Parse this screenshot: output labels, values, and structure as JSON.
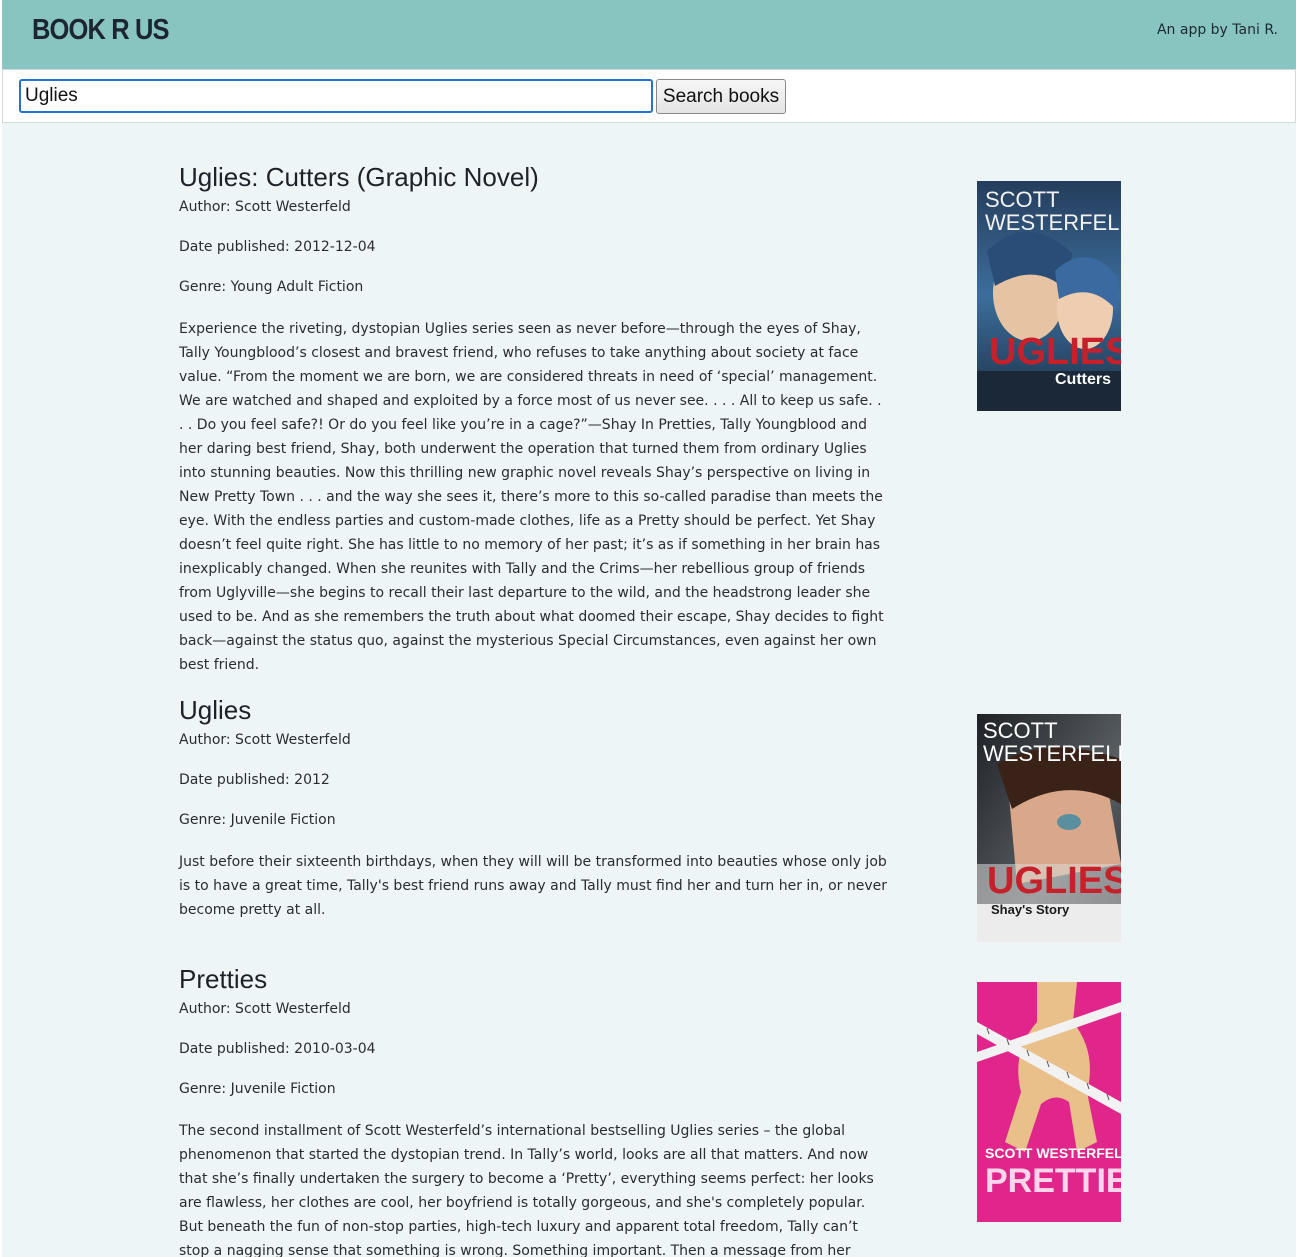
{
  "header": {
    "logo": "BOOK R US",
    "byline": "An app by Tani R."
  },
  "search": {
    "value": "Uglies",
    "button_label": "Search books"
  },
  "books": [
    {
      "title": "Uglies: Cutters (Graphic Novel)",
      "author": "Author: Scott Westerfeld",
      "date": "Date published: 2012-12-04",
      "genre": "Genre: Young Adult Fiction",
      "description": "Experience the riveting, dystopian Uglies series seen as never before—through the eyes of Shay, Tally Youngblood’s closest and bravest friend, who refuses to take anything about society at face value. “From the moment we are born, we are considered threats in need of ‘special’ management. We are watched and shaped and exploited by a force most of us never see. . . . All to keep us safe. . . . Do you feel safe?! Or do you feel like you’re in a cage?”—Shay In Pretties, Tally Youngblood and her daring best friend, Shay, both underwent the operation that turned them from ordinary Uglies into stunning beauties. Now this thrilling new graphic novel reveals Shay’s perspective on living in New Pretty Town . . . and the way she sees it, there’s more to this so-called paradise than meets the eye. With the endless parties and custom-made clothes, life as a Pretty should be perfect. Yet Shay doesn’t feel quite right. She has little to no memory of her past; it’s as if something in her brain has inexplicably changed. When she reunites with Tally and the Crims—her rebellious group of friends from Uglyville—she begins to recall their last departure to the wild, and the headstrong leader she used to be. And as she remembers the truth about what doomed their escape, Shay decides to fight back—against the status quo, against the mysterious Special Circumstances, even against her own best friend.",
      "cover": {
        "author_line1": "SCOTT",
        "author_line2": "WESTERFELD",
        "series": "UGLIES",
        "subtitle": "Cutters",
        "bg": "#2f5a86",
        "series_color": "#c8202a"
      }
    },
    {
      "title": "Uglies",
      "author": "Author: Scott Westerfeld",
      "date": "Date published: 2012",
      "genre": "Genre: Juvenile Fiction",
      "description": "Just before their sixteenth birthdays, when they will will be transformed into beauties whose only job is to have a great time, Tally's best friend runs away and Tally must find her and turn her in, or never become pretty at all.",
      "cover": {
        "author_line1": "SCOTT",
        "author_line2": "WESTERFELD",
        "series": "UGLIES",
        "subtitle": "Shay's Story",
        "bg": "#3a3f44",
        "series_color": "#c8202a"
      }
    },
    {
      "title": "Pretties",
      "author": "Author: Scott Westerfeld",
      "date": "Date published: 2010-03-04",
      "genre": "Genre: Juvenile Fiction",
      "description": "The second installment of Scott Westerfeld’s international bestselling Uglies series – the global phenomenon that started the dystopian trend. In Tally’s world, looks are all that matters. And now that she’s finally undertaken the surgery to become a ‘Pretty’, everything seems perfect: her looks are flawless, her clothes are cool, her boyfriend is totally gorgeous, and she's completely popular. But beneath the fun of non-stop parties, high-tech luxury and apparent total freedom, Tally can’t stop a nagging sense that something is wrong. Something important. Then a message from her ‘Ugly’ past",
      "cover": {
        "author_line1": "SCOTT WESTERFELD",
        "series": "PRETTIES",
        "bg": "#e0268a",
        "series_color": "#ffd5ec"
      }
    }
  ]
}
